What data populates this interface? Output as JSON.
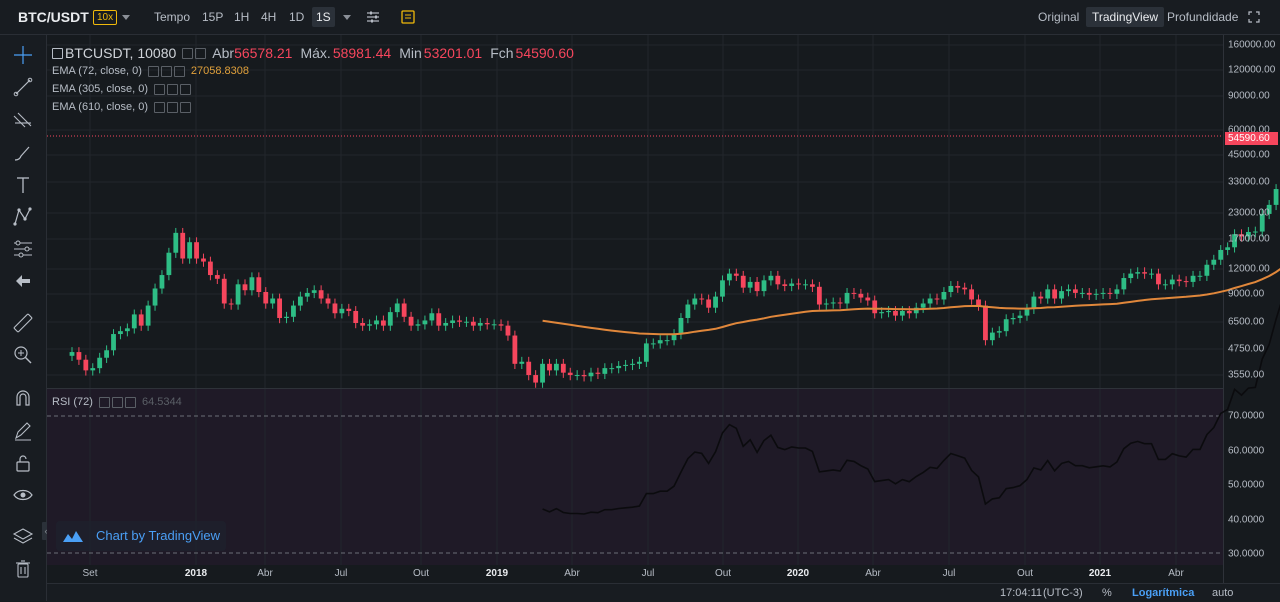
{
  "header": {
    "pair": "BTC/USDT",
    "leverage": "10x",
    "time_label": "Tempo",
    "intervals": [
      "15P",
      "1H",
      "4H",
      "1D",
      "1S"
    ],
    "active_interval": "1S",
    "views": [
      "Original",
      "TradingView",
      "Profundidade"
    ],
    "active_view": "TradingView"
  },
  "legend": {
    "symbol": "BTCUSDT, 10080",
    "open_label": "Abr",
    "open_value": "56578.21",
    "high_label": "Máx.",
    "high_value": "58981.44",
    "low_label": "Min",
    "low_value": "53201.01",
    "close_label": "Fch",
    "close_value": "54590.60",
    "ema1_label": "EMA (72, close, 0)",
    "ema1_value": "27058.8308",
    "ema2_label": "EMA (305, close, 0)",
    "ema3_label": "EMA (610, close, 0)"
  },
  "rsi": {
    "label": "RSI (72)",
    "value": "64.5344"
  },
  "tv_badge": "Chart by TradingView",
  "price_axis": [
    "160000.00",
    "120000.00",
    "90000.00",
    "60000.00",
    "45000.00",
    "33000.00",
    "23000.00",
    "17000.00",
    "12000.00",
    "9000.00",
    "6500.00",
    "4750.00",
    "3550.00"
  ],
  "rsi_axis": [
    "70.0000",
    "60.0000",
    "50.0000",
    "40.0000",
    "30.0000"
  ],
  "last_price_tag": "54590.60",
  "x_axis": [
    "Set",
    "2018",
    "Abr",
    "Jul",
    "Out",
    "2019",
    "Abr",
    "Jul",
    "Out",
    "2020",
    "Abr",
    "Jul",
    "Out",
    "2021",
    "Abr"
  ],
  "x_axis_bold": [
    "2018",
    "2019",
    "2020",
    "2021"
  ],
  "status": {
    "time": "17:04:11",
    "tz": "(UTC-3)",
    "percent": "%",
    "log": "Logarítmica",
    "auto": "auto"
  },
  "colors": {
    "up": "#2ebd85",
    "down": "#f6465d",
    "ema": "#e0873b",
    "rsi_line": "#0b0b0e",
    "bg": "#161a1e",
    "rsi_bg": "#1f1a27"
  },
  "chart_data": {
    "type": "candlestick",
    "symbol": "BTCUSDT",
    "interval": "1W",
    "scale": "log",
    "ylim": [
      3000,
      200000
    ],
    "series": [
      {
        "name": "Price",
        "points": [
          [
            "2017-08-28",
            4400,
            4600
          ],
          [
            "2017-09-04",
            4600,
            4200
          ],
          [
            "2017-09-11",
            4200,
            3700
          ],
          [
            "2017-09-18",
            3700,
            3800
          ],
          [
            "2017-09-25",
            3800,
            4300
          ],
          [
            "2017-10-02",
            4300,
            4700
          ],
          [
            "2017-10-09",
            4700,
            5700
          ],
          [
            "2017-10-16",
            5700,
            5900
          ],
          [
            "2017-10-23",
            5900,
            6100
          ],
          [
            "2017-10-30",
            6100,
            7200
          ],
          [
            "2017-11-06",
            7200,
            6300
          ],
          [
            "2017-11-13",
            6300,
            8000
          ],
          [
            "2017-11-20",
            8000,
            9800
          ],
          [
            "2017-11-27",
            9800,
            11500
          ],
          [
            "2017-12-04",
            11500,
            15000
          ],
          [
            "2017-12-11",
            15000,
            19000
          ],
          [
            "2017-12-18",
            19000,
            14000
          ],
          [
            "2017-12-25",
            14000,
            17000
          ],
          [
            "2018-01-01",
            17000,
            14000
          ],
          [
            "2018-01-08",
            14000,
            13500
          ],
          [
            "2018-01-15",
            13500,
            11500
          ],
          [
            "2018-01-22",
            11500,
            11000
          ],
          [
            "2018-01-29",
            11000,
            8200
          ],
          [
            "2018-02-05",
            8200,
            8100
          ],
          [
            "2018-02-12",
            8100,
            10300
          ],
          [
            "2018-02-19",
            10300,
            9600
          ],
          [
            "2018-02-26",
            9600,
            11200
          ],
          [
            "2018-03-05",
            11200,
            9400
          ],
          [
            "2018-03-12",
            9400,
            8200
          ],
          [
            "2018-03-19",
            8200,
            8700
          ],
          [
            "2018-03-26",
            8700,
            6900
          ],
          [
            "2018-04-02",
            6900,
            7000
          ],
          [
            "2018-04-09",
            7000,
            8000
          ],
          [
            "2018-04-16",
            8000,
            8900
          ],
          [
            "2018-04-23",
            8900,
            9300
          ],
          [
            "2018-04-30",
            9300,
            9600
          ],
          [
            "2018-05-07",
            9600,
            8700
          ],
          [
            "2018-05-14",
            8700,
            8200
          ],
          [
            "2018-05-21",
            8200,
            7300
          ],
          [
            "2018-05-28",
            7300,
            7700
          ],
          [
            "2018-06-04",
            7700,
            7500
          ],
          [
            "2018-06-11",
            7500,
            6500
          ],
          [
            "2018-06-18",
            6500,
            6300
          ],
          [
            "2018-06-25",
            6300,
            6400
          ],
          [
            "2018-07-02",
            6400,
            6700
          ],
          [
            "2018-07-09",
            6700,
            6300
          ],
          [
            "2018-07-16",
            6300,
            7400
          ],
          [
            "2018-07-23",
            7400,
            8200
          ],
          [
            "2018-07-30",
            8200,
            7000
          ],
          [
            "2018-08-06",
            7000,
            6300
          ],
          [
            "2018-08-13",
            6300,
            6400
          ],
          [
            "2018-08-20",
            6400,
            6700
          ],
          [
            "2018-08-27",
            6700,
            7300
          ],
          [
            "2018-09-03",
            7300,
            6300
          ],
          [
            "2018-09-10",
            6300,
            6500
          ],
          [
            "2018-09-17",
            6500,
            6700
          ],
          [
            "2018-09-24",
            6700,
            6600
          ],
          [
            "2018-10-01",
            6600,
            6600
          ],
          [
            "2018-10-08",
            6600,
            6300
          ],
          [
            "2018-10-15",
            6300,
            6500
          ],
          [
            "2018-10-22",
            6500,
            6400
          ],
          [
            "2018-10-29",
            6400,
            6400
          ],
          [
            "2018-11-05",
            6400,
            6300
          ],
          [
            "2018-11-12",
            6300,
            5600
          ],
          [
            "2018-11-19",
            5600,
            4000
          ],
          [
            "2018-11-26",
            4000,
            4100
          ],
          [
            "2018-12-03",
            4100,
            3500
          ],
          [
            "2018-12-10",
            3500,
            3200
          ],
          [
            "2018-12-17",
            3200,
            4000
          ],
          [
            "2018-12-24",
            4000,
            3700
          ],
          [
            "2018-12-31",
            3700,
            4000
          ],
          [
            "2019-01-07",
            4000,
            3600
          ],
          [
            "2019-01-14",
            3600,
            3500
          ],
          [
            "2019-01-21",
            3500,
            3500
          ],
          [
            "2019-01-28",
            3500,
            3450
          ],
          [
            "2019-02-04",
            3450,
            3600
          ],
          [
            "2019-02-11",
            3600,
            3550
          ],
          [
            "2019-02-18",
            3550,
            3800
          ],
          [
            "2019-02-25",
            3800,
            3800
          ],
          [
            "2019-03-04",
            3800,
            3900
          ],
          [
            "2019-03-11",
            3900,
            3950
          ],
          [
            "2019-03-18",
            3950,
            4000
          ],
          [
            "2019-03-25",
            4000,
            4100
          ],
          [
            "2019-04-01",
            4100,
            5100
          ],
          [
            "2019-04-08",
            5100,
            5100
          ],
          [
            "2019-04-15",
            5100,
            5300
          ],
          [
            "2019-04-22",
            5300,
            5300
          ],
          [
            "2019-04-29",
            5300,
            5700
          ],
          [
            "2019-05-06",
            5700,
            6900
          ],
          [
            "2019-05-13",
            6900,
            8100
          ],
          [
            "2019-05-20",
            8100,
            8700
          ],
          [
            "2019-05-27",
            8700,
            8600
          ],
          [
            "2019-06-03",
            8600,
            7800
          ],
          [
            "2019-06-10",
            7800,
            8900
          ],
          [
            "2019-06-17",
            8900,
            10800
          ],
          [
            "2019-06-24",
            10800,
            11700
          ],
          [
            "2019-07-01",
            11700,
            11400
          ],
          [
            "2019-07-08",
            11400,
            9900
          ],
          [
            "2019-07-15",
            9900,
            10600
          ],
          [
            "2019-07-22",
            10600,
            9500
          ],
          [
            "2019-07-29",
            9500,
            10800
          ],
          [
            "2019-08-05",
            10800,
            11400
          ],
          [
            "2019-08-12",
            11400,
            10300
          ],
          [
            "2019-08-19",
            10300,
            10100
          ],
          [
            "2019-08-26",
            10100,
            10400
          ],
          [
            "2019-09-02",
            10400,
            10300
          ],
          [
            "2019-09-09",
            10300,
            10300
          ],
          [
            "2019-09-16",
            10300,
            10000
          ],
          [
            "2019-09-23",
            10000,
            8100
          ],
          [
            "2019-09-30",
            8100,
            8200
          ],
          [
            "2019-10-07",
            8200,
            8300
          ],
          [
            "2019-10-14",
            8300,
            8200
          ],
          [
            "2019-10-21",
            8200,
            9300
          ],
          [
            "2019-10-28",
            9300,
            9200
          ],
          [
            "2019-11-04",
            9200,
            8800
          ],
          [
            "2019-11-11",
            8800,
            8500
          ],
          [
            "2019-11-18",
            8500,
            7300
          ],
          [
            "2019-11-25",
            7300,
            7400
          ],
          [
            "2019-12-02",
            7400,
            7500
          ],
          [
            "2019-12-09",
            7500,
            7100
          ],
          [
            "2019-12-16",
            7100,
            7500
          ],
          [
            "2019-12-23",
            7500,
            7300
          ],
          [
            "2019-12-30",
            7300,
            7800
          ],
          [
            "2020-01-06",
            7800,
            8200
          ],
          [
            "2020-01-13",
            8200,
            8700
          ],
          [
            "2020-01-20",
            8700,
            8600
          ],
          [
            "2020-01-27",
            8600,
            9400
          ],
          [
            "2020-02-03",
            9400,
            10100
          ],
          [
            "2020-02-10",
            10100,
            9900
          ],
          [
            "2020-02-17",
            9900,
            9700
          ],
          [
            "2020-02-24",
            9700,
            8600
          ],
          [
            "2020-03-02",
            8600,
            8000
          ],
          [
            "2020-03-09",
            8000,
            5300
          ],
          [
            "2020-03-16",
            5300,
            5800
          ],
          [
            "2020-03-23",
            5800,
            5900
          ],
          [
            "2020-03-30",
            5900,
            6800
          ],
          [
            "2020-04-06",
            6800,
            6900
          ],
          [
            "2020-04-13",
            6900,
            7100
          ],
          [
            "2020-04-20",
            7100,
            7700
          ],
          [
            "2020-04-27",
            7700,
            8900
          ],
          [
            "2020-05-04",
            8900,
            8700
          ],
          [
            "2020-05-11",
            8700,
            9700
          ],
          [
            "2020-05-18",
            9700,
            8700
          ],
          [
            "2020-05-25",
            8700,
            9500
          ],
          [
            "2020-06-01",
            9500,
            9700
          ],
          [
            "2020-06-08",
            9700,
            9300
          ],
          [
            "2020-06-15",
            9300,
            9300
          ],
          [
            "2020-06-22",
            9300,
            9100
          ],
          [
            "2020-06-29",
            9100,
            9200
          ],
          [
            "2020-07-06",
            9200,
            9300
          ],
          [
            "2020-07-13",
            9300,
            9200
          ],
          [
            "2020-07-20",
            9200,
            9700
          ],
          [
            "2020-07-27",
            9700,
            11100
          ],
          [
            "2020-08-03",
            11100,
            11700
          ],
          [
            "2020-08-10",
            11700,
            11900
          ],
          [
            "2020-08-17",
            11900,
            11700
          ],
          [
            "2020-08-24",
            11700,
            11700
          ],
          [
            "2020-08-31",
            11700,
            10300
          ],
          [
            "2020-09-07",
            10300,
            10300
          ],
          [
            "2020-09-14",
            10300,
            10900
          ],
          [
            "2020-09-21",
            10900,
            10700
          ],
          [
            "2020-09-28",
            10700,
            10600
          ],
          [
            "2020-10-05",
            10600,
            11400
          ],
          [
            "2020-10-12",
            11400,
            11400
          ],
          [
            "2020-10-19",
            11400,
            13000
          ],
          [
            "2020-10-26",
            13000,
            13800
          ],
          [
            "2020-11-02",
            13800,
            15500
          ],
          [
            "2020-11-09",
            15500,
            16000
          ],
          [
            "2020-11-16",
            16000,
            18700
          ],
          [
            "2020-11-23",
            18700,
            18200
          ],
          [
            "2020-11-30",
            18200,
            19200
          ],
          [
            "2020-12-07",
            19200,
            19300
          ],
          [
            "2020-12-14",
            19300,
            23800
          ],
          [
            "2020-12-21",
            23800,
            26500
          ],
          [
            "2020-12-28",
            26500,
            32000
          ],
          [
            "2021-01-04",
            32000,
            38000
          ],
          [
            "2021-01-11",
            38000,
            36000
          ],
          [
            "2021-01-18",
            36000,
            32300
          ],
          [
            "2021-01-25",
            32300,
            34300
          ],
          [
            "2021-02-01",
            34300,
            39300
          ],
          [
            "2021-02-08",
            39300,
            48600
          ],
          [
            "2021-02-15",
            48600,
            57500
          ],
          [
            "2021-02-22",
            57500,
            45200
          ],
          [
            "2021-03-01",
            45200,
            51000
          ],
          [
            "2021-03-08",
            51000,
            61200
          ],
          [
            "2021-03-15",
            61200,
            57400
          ],
          [
            "2021-03-22",
            57400,
            55800
          ],
          [
            "2021-03-29",
            55800,
            58000
          ],
          [
            "2021-04-05",
            58000,
            60000
          ],
          [
            "2021-04-12",
            60000,
            56600
          ],
          [
            "2021-04-19",
            56600,
            49100
          ],
          [
            "2021-04-26",
            49100,
            56578
          ],
          [
            "2021-05-03",
            56578,
            54590
          ]
        ]
      },
      {
        "name": "EMA (72, close, 0)",
        "last": 27058.8308
      }
    ],
    "rsi": {
      "name": "RSI (72)",
      "last": 64.5344,
      "ylim": [
        28,
        78
      ],
      "bands": [
        30,
        70
      ]
    }
  }
}
